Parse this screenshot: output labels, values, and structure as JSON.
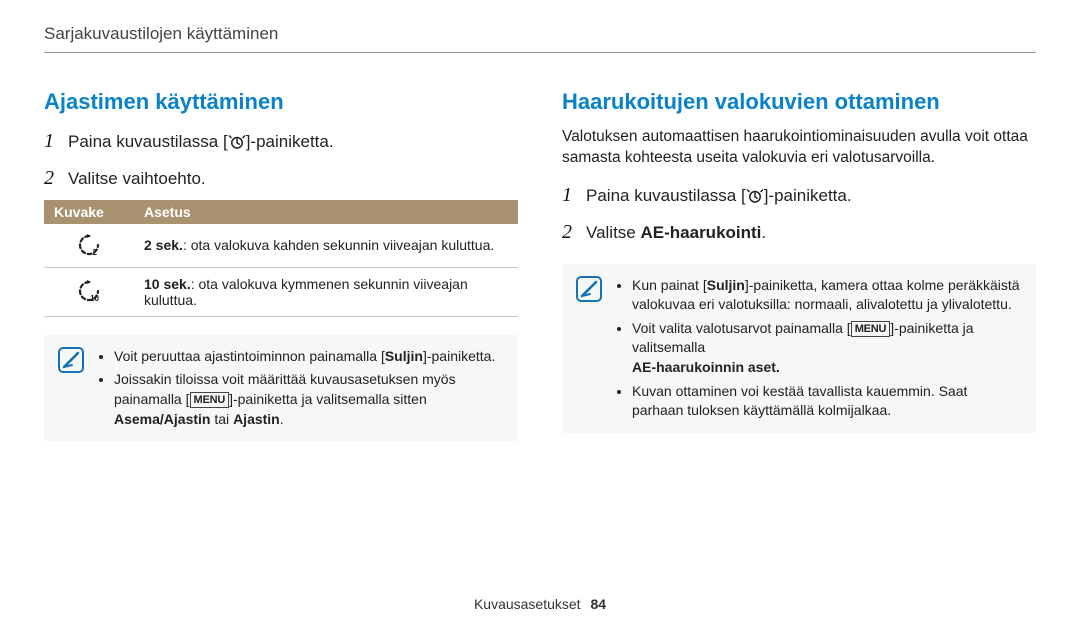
{
  "breadcrumb": "Sarjakuvaustilojen käyttäminen",
  "left": {
    "heading": "Ajastimen käyttäminen",
    "step1_a": "Paina kuvaustilassa [",
    "step1_b": "]-painiketta.",
    "step2": "Valitse vaihtoehto.",
    "table": {
      "h_icon": "Kuvake",
      "h_setting": "Asetus",
      "row1_bold": "2 sek.",
      "row1_rest": ": ota valokuva kahden sekunnin viiveajan kuluttua.",
      "row2_bold": "10 sek.",
      "row2_rest": ": ota valokuva kymmenen sekunnin viiveajan kuluttua."
    },
    "note": {
      "b1_a": "Voit peruuttaa ajastintoiminnon painamalla [",
      "b1_suljin": "Suljin",
      "b1_b": "]-painiketta.",
      "b2_a": "Joissakin tiloissa voit määrittää kuvausasetuksen myös painamalla [",
      "b2_b": "]-painiketta ja valitsemalla sitten ",
      "b2_bold": "Asema/Ajastin",
      "b2_or": " tai ",
      "b2_bold2": "Ajastin",
      "b2_end": "."
    }
  },
  "right": {
    "heading": "Haarukoitujen valokuvien ottaminen",
    "intro": "Valotuksen automaattisen haarukointiominaisuuden avulla voit ottaa samasta kohteesta useita valokuvia eri valotusarvoilla.",
    "step1_a": "Paina kuvaustilassa [",
    "step1_b": "]-painiketta.",
    "step2_a": "Valitse ",
    "step2_bold": "AE-haarukointi",
    "step2_end": ".",
    "note": {
      "b1_a": "Kun painat [",
      "b1_suljin": "Suljin",
      "b1_b": "]-painiketta, kamera ottaa kolme peräkkäistä valokuvaa eri valotuksilla: normaali, alivalotettu ja ylivalotettu.",
      "b2_a": "Voit valita valotusarvot painamalla [",
      "b2_b": "]-painiketta ja valitsemalla ",
      "b2_bold": "AE-haarukoinnin aset.",
      "b3": "Kuvan ottaminen voi kestää tavallista kauemmin. Saat parhaan tuloksen käyttämällä kolmijalkaa."
    }
  },
  "menu_label": "MENU",
  "footer_section": "Kuvausasetukset",
  "footer_page": "84"
}
